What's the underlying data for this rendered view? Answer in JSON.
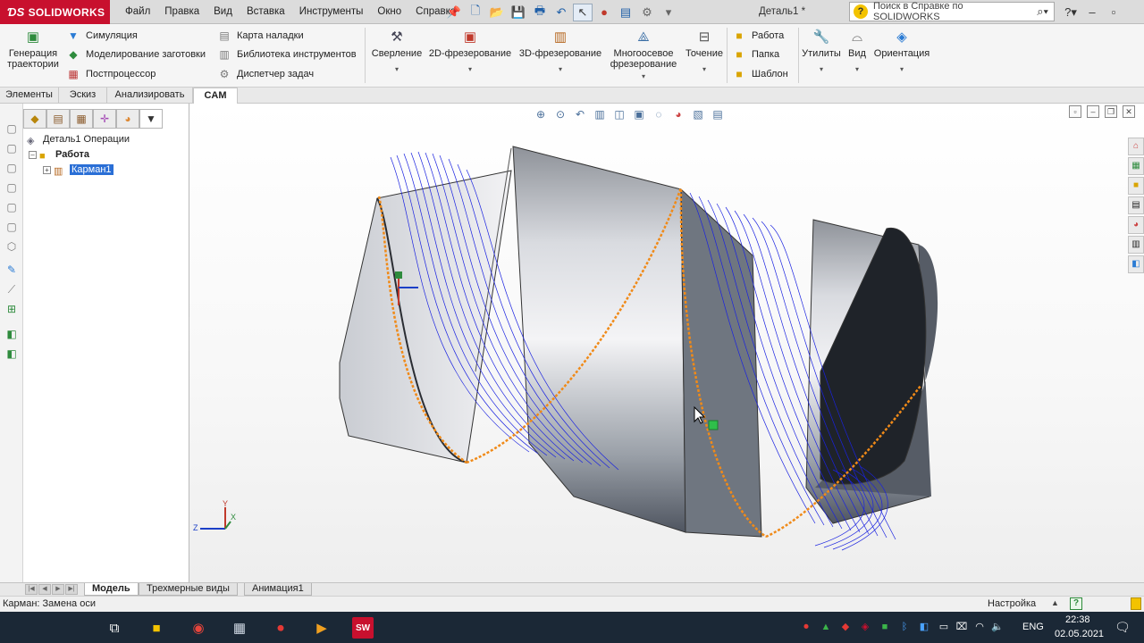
{
  "app": {
    "brand": "SOLIDWORKS",
    "doc_title": "Деталь1 *"
  },
  "menu": [
    "Файл",
    "Правка",
    "Вид",
    "Вставка",
    "Инструменты",
    "Окно",
    "Справка"
  ],
  "help_search": {
    "placeholder": "Поиск в Справке по SOLIDWORKS"
  },
  "ribbon": {
    "generate": "Генерация траектории",
    "col1": [
      "Симуляция",
      "Моделирование заготовки",
      "Постпроцессор"
    ],
    "col2": [
      "Карта наладки",
      "Библиотека инструментов",
      "Диспетчер задач"
    ],
    "ops": [
      "Сверление",
      "2D-фрезерование",
      "3D-фрезерование",
      "Многоосевое фрезерование",
      "Точение"
    ],
    "col3": [
      "Работа",
      "Папка",
      "Шаблон"
    ],
    "right": [
      "Утилиты",
      "Вид",
      "Ориентация"
    ]
  },
  "tabs": [
    "Элементы",
    "Эскиз",
    "Анализировать",
    "CAM"
  ],
  "tree": {
    "root": "Деталь1 Операции",
    "job": "Работа",
    "pocket": "Карман1"
  },
  "bottom_tabs": [
    "Модель",
    "Трехмерные виды",
    "Анимация1"
  ],
  "status": {
    "text": "Карман: Замена оси",
    "units": "Настройка"
  },
  "taskbar": {
    "lang": "ENG",
    "time": "22:38",
    "date": "02.05.2021"
  },
  "colors": {
    "toolpath": "#1a22e0",
    "edge_highlight": "#f08a18",
    "brand_red": "#c8102e"
  }
}
